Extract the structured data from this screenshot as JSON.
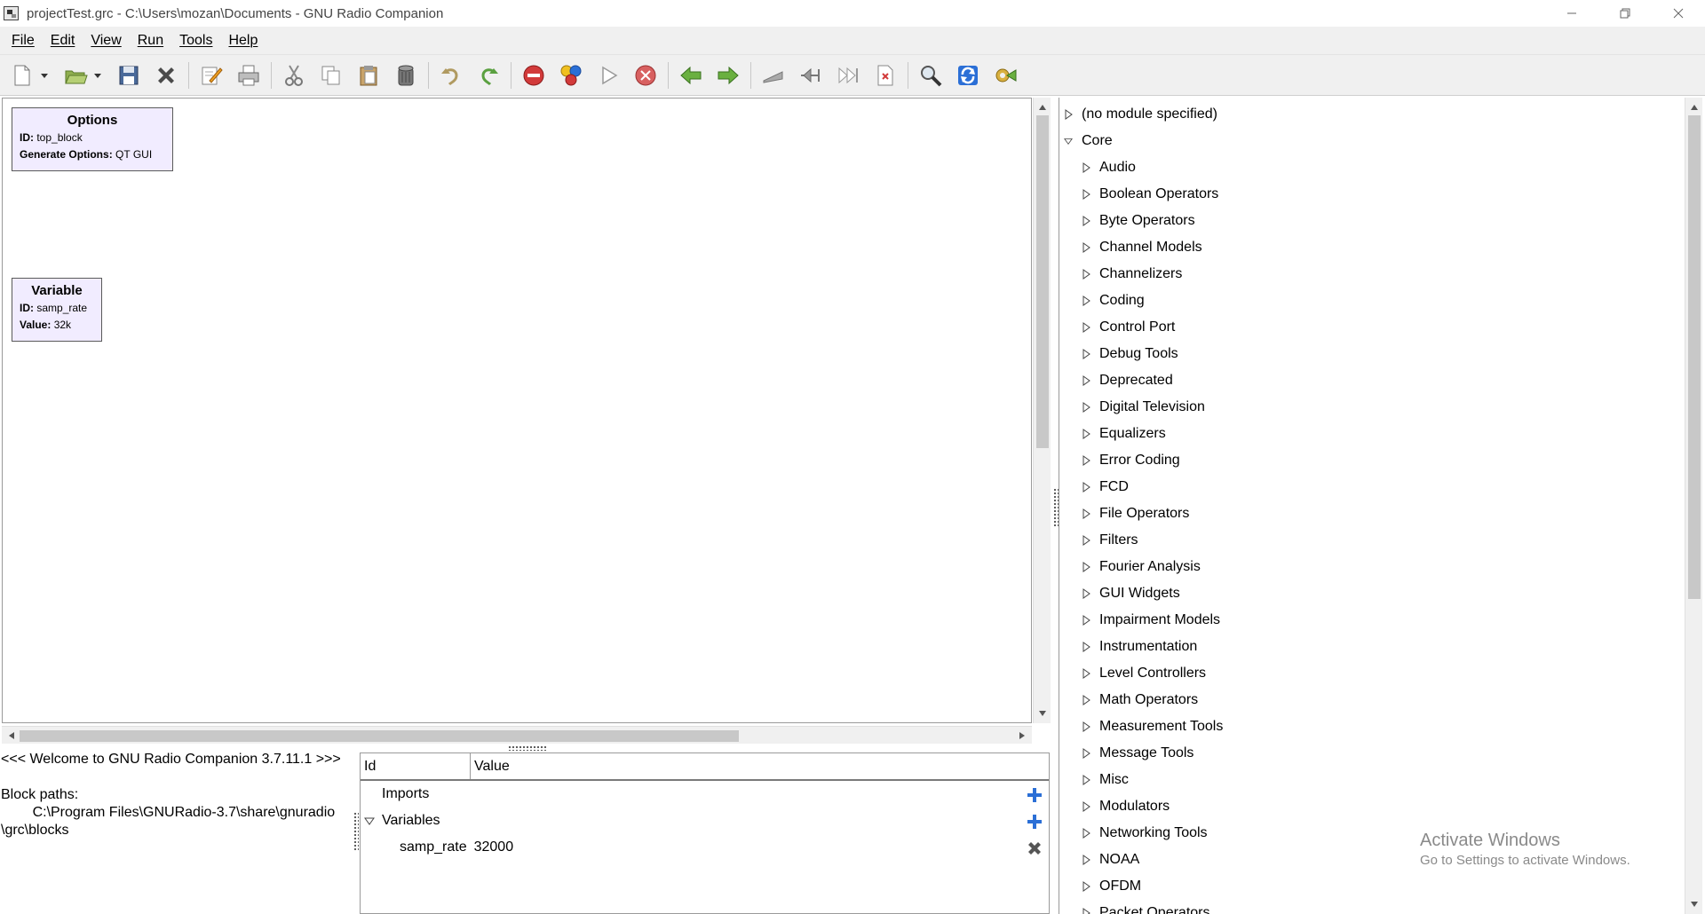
{
  "window": {
    "title": "projectTest.grc - C:\\Users\\mozan\\Documents - GNU Radio Companion"
  },
  "menu": [
    "File",
    "Edit",
    "View",
    "Run",
    "Tools",
    "Help"
  ],
  "blocks": {
    "options": {
      "name": "Options",
      "id_label": "ID:",
      "id_value": "top_block",
      "gen_label": "Generate Options:",
      "gen_value": "QT GUI"
    },
    "variable": {
      "name": "Variable",
      "id_label": "ID:",
      "id_value": "samp_rate",
      "value_label": "Value:",
      "value_value": "32k"
    }
  },
  "console": {
    "welcome": "<<< Welcome to GNU Radio Companion 3.7.11.1 >>>",
    "paths_label": "Block paths:",
    "path_line1": "        C:\\Program Files\\GNURadio-3.7\\share\\gnuradio",
    "path_line2": "\\grc\\blocks"
  },
  "variable_editor": {
    "col_id": "Id",
    "col_value": "Value",
    "imports": "Imports",
    "variables": "Variables",
    "var_name": "samp_rate",
    "var_value": "32000"
  },
  "tree": {
    "no_module": "(no module specified)",
    "core": "Core",
    "categories": [
      "Audio",
      "Boolean Operators",
      "Byte Operators",
      "Channel Models",
      "Channelizers",
      "Coding",
      "Control Port",
      "Debug Tools",
      "Deprecated",
      "Digital Television",
      "Equalizers",
      "Error Coding",
      "FCD",
      "File Operators",
      "Filters",
      "Fourier Analysis",
      "GUI Widgets",
      "Impairment Models",
      "Instrumentation",
      "Level Controllers",
      "Math Operators",
      "Measurement Tools",
      "Message Tools",
      "Misc",
      "Modulators",
      "Networking Tools",
      "NOAA",
      "OFDM",
      "Packet Operators"
    ]
  },
  "watermark": {
    "line1": "Activate Windows",
    "line2": "Go to Settings to activate Windows."
  },
  "colors": {
    "block_fill": "#f1ecff",
    "toolbar_bg": "#f0f0f0",
    "accent_blue": "#2b6fd6"
  }
}
